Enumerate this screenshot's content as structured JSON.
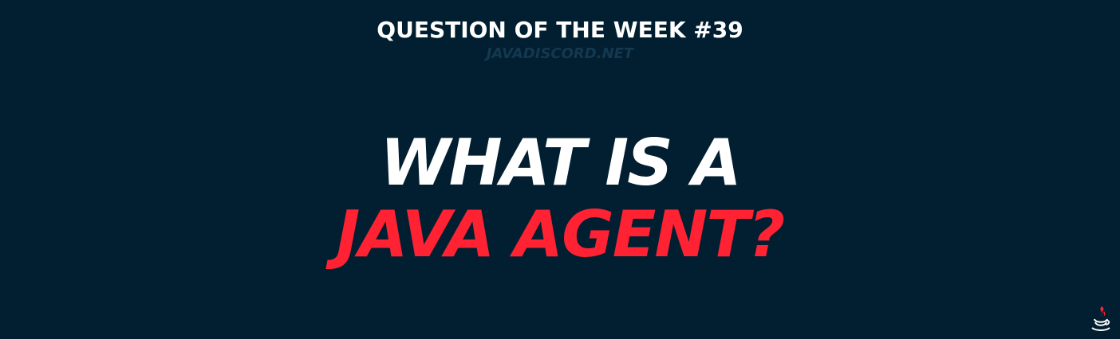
{
  "header": {
    "title": "QUESTION OF THE WEEK #39",
    "website": "JAVADISCORD.NET"
  },
  "headline": {
    "line1": "WHAT IS A",
    "line2": "JAVA AGENT?"
  },
  "colors": {
    "background": "#021f31",
    "accent": "#ff2233",
    "primary_text": "#ffffff",
    "muted_text": "#13384f"
  },
  "icons": {
    "corner_logo": "java-coffee-cup-icon"
  }
}
